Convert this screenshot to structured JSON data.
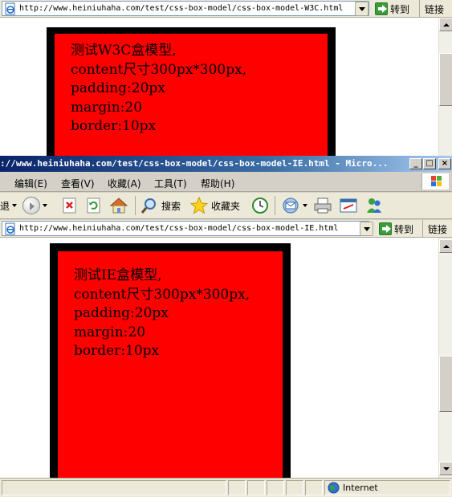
{
  "window1": {
    "address_url": "http://www.heiniuhaha.com/test/css-box-model/css-box-model-W3C.html",
    "go_label": "转到",
    "links_label": "链接",
    "content_lines": [
      "测试W3C盒模型,",
      "content尺寸300px*300px,",
      "padding:20px",
      "margin:20",
      "border:10px"
    ]
  },
  "window2": {
    "title": "://www.heiniuhaha.com/test/css-box-model/css-box-model-IE.html - Micro...",
    "menu": {
      "edit": "编辑(E)",
      "view": "查看(V)",
      "favorites": "收藏(A)",
      "tools": "工具(T)",
      "help": "帮助(H)"
    },
    "toolbar": {
      "back_fragment": "退",
      "search_label": "搜索",
      "favorites_label": "收藏夹"
    },
    "address_url": "http://www.heiniuhaha.com/test/css-box-model/css-box-model-IE.html",
    "go_label": "转到",
    "links_label": "链接",
    "content_lines": [
      "测试IE盒模型,",
      "content尺寸300px*300px,",
      "padding:20px",
      "margin:20",
      "border:10px"
    ],
    "status": {
      "zone_label": "Internet"
    }
  },
  "colors": {
    "box_background": "#ff0000",
    "box_border": "#000000",
    "title_bar": "#0a246a"
  }
}
